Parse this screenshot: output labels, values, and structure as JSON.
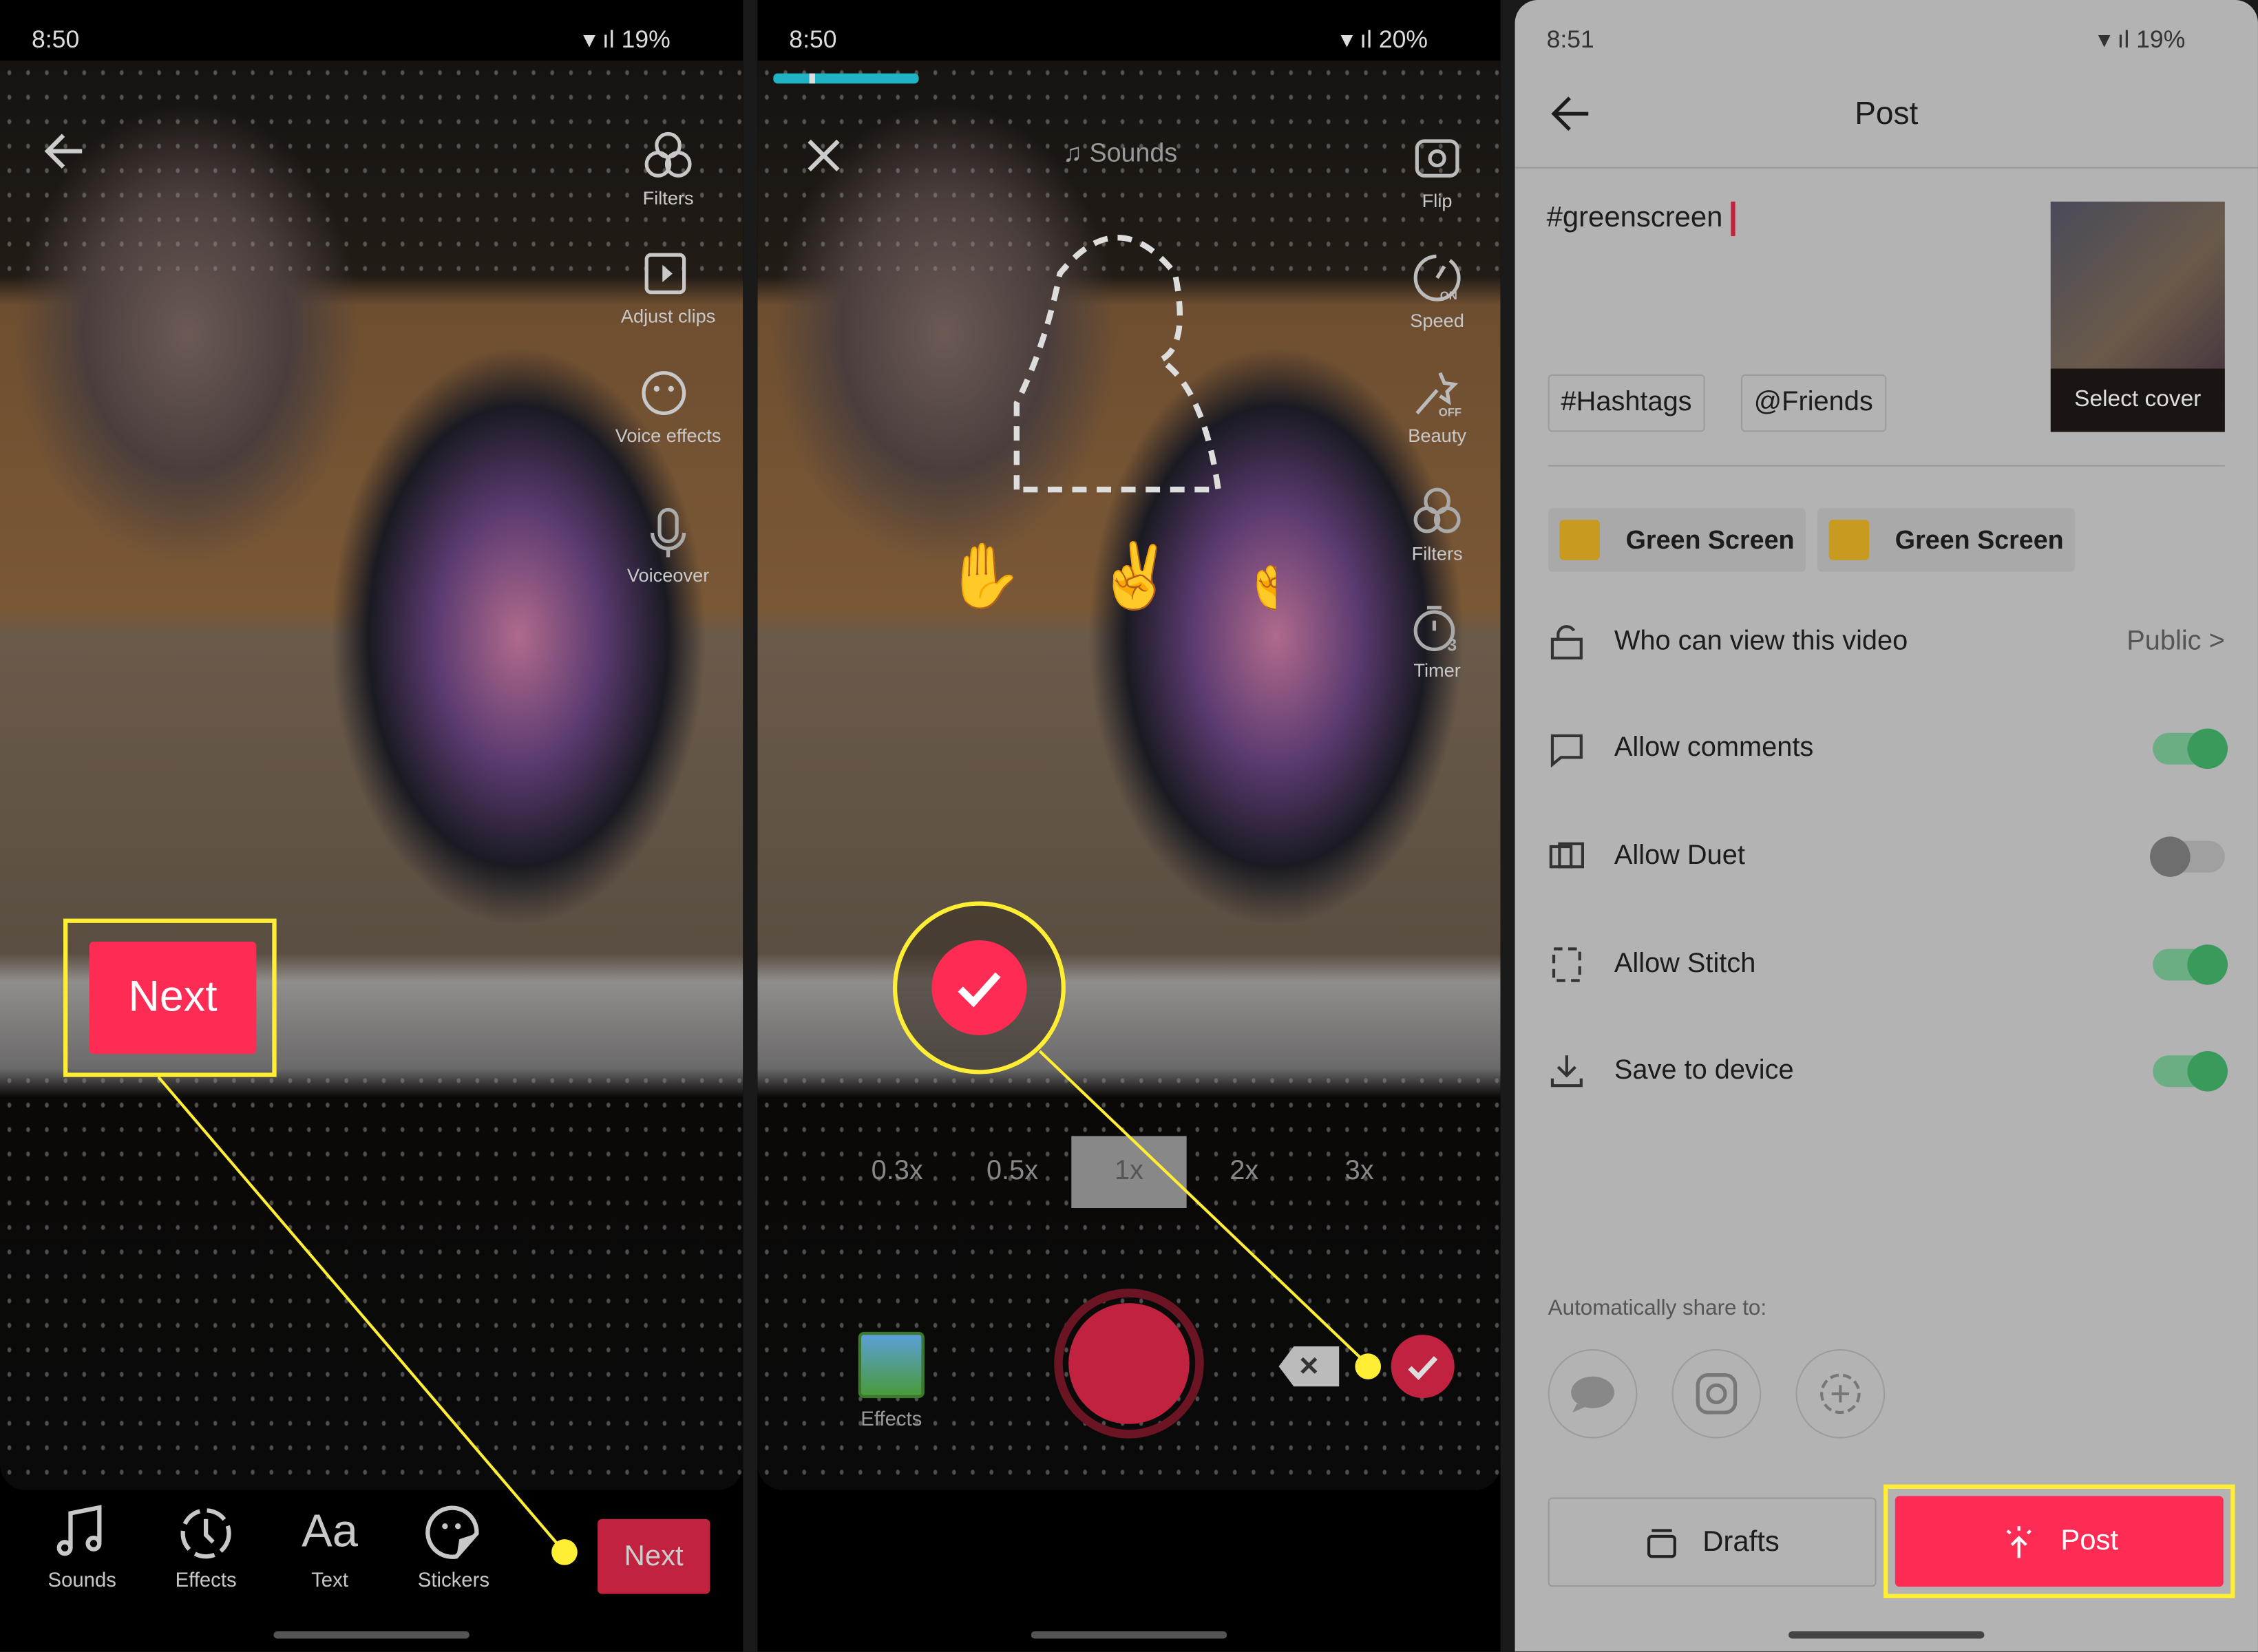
{
  "panel1": {
    "status": {
      "time": "8:50",
      "battery": "19%"
    },
    "right_tools": [
      {
        "label": "Filters",
        "icon": "filters-icon"
      },
      {
        "label": "Adjust clips",
        "icon": "adjust-clips-icon"
      },
      {
        "label": "Voice effects",
        "icon": "voice-effects-icon"
      },
      {
        "label": "Voiceover",
        "icon": "microphone-icon"
      }
    ],
    "callout_label": "Next",
    "bottom_tools": [
      {
        "label": "Sounds",
        "icon": "music-note-icon"
      },
      {
        "label": "Effects",
        "icon": "effects-timer-icon"
      },
      {
        "label": "Text",
        "icon": "text-aa-icon"
      },
      {
        "label": "Stickers",
        "icon": "sticker-icon"
      }
    ],
    "next_label": "Next"
  },
  "panel2": {
    "status": {
      "time": "8:50",
      "battery": "20%"
    },
    "sounds_label": "Sounds",
    "right_tools": [
      {
        "label": "Flip"
      },
      {
        "label": "Speed",
        "badge": "ON"
      },
      {
        "label": "Beauty",
        "badge": "OFF"
      },
      {
        "label": "Filters"
      },
      {
        "label": "Timer",
        "badge": "3"
      }
    ],
    "speeds": [
      "0.3x",
      "0.5x",
      "1x",
      "2x",
      "3x"
    ],
    "selected_speed": "1x",
    "effects_label": "Effects",
    "recording_progress": 0.3
  },
  "panel3": {
    "status": {
      "time": "8:51",
      "battery": "19%"
    },
    "title": "Post",
    "caption": "#greenscreen",
    "select_cover": "Select cover",
    "chips": [
      "Hashtags",
      "Friends"
    ],
    "chip_prefixes": [
      "#",
      "@"
    ],
    "effects": [
      "Green Screen",
      "Green Screen"
    ],
    "who_can_view": {
      "label": "Who can view this video",
      "value": "Public"
    },
    "toggles": [
      {
        "label": "Allow comments",
        "on": true
      },
      {
        "label": "Allow Duet",
        "on": false
      },
      {
        "label": "Allow Stitch",
        "on": true
      },
      {
        "label": "Save to device",
        "on": true
      }
    ],
    "share_label": "Automatically share to:",
    "drafts": "Drafts",
    "post": "Post"
  },
  "colors": {
    "accent": "#fe2c55",
    "highlight": "#ffee33",
    "toggle_on": "#3a9a5c",
    "progress": "#20b3c3"
  }
}
